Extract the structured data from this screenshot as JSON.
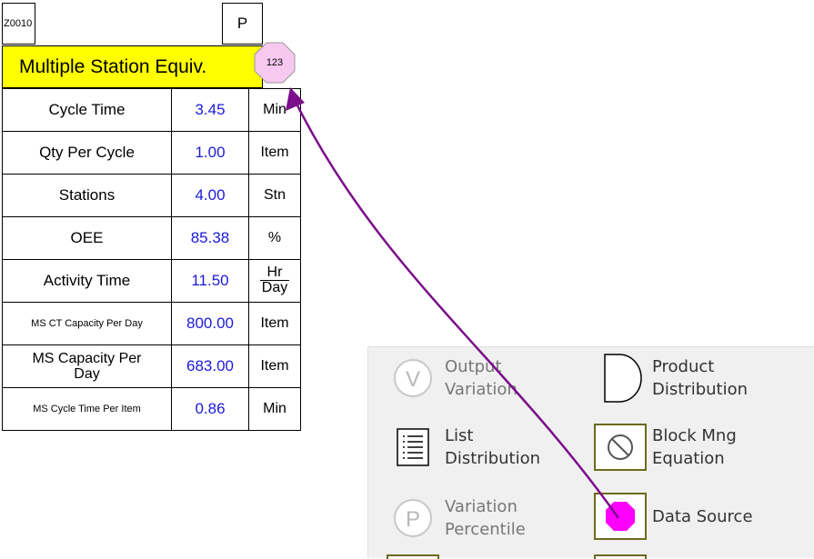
{
  "block": {
    "id": "Z0010",
    "type_letter": "P",
    "title": "Multiple Station Equiv.",
    "badge": "123",
    "rows": [
      {
        "label": "Cycle Time",
        "value": "3.45",
        "unit": "Min"
      },
      {
        "label": "Qty Per Cycle",
        "value": "1.00",
        "unit": "Item"
      },
      {
        "label": "Stations",
        "value": "4.00",
        "unit": "Stn"
      },
      {
        "label": "OEE",
        "value": "85.38",
        "unit": "%"
      },
      {
        "label": "Activity Time",
        "value": "11.50",
        "unit_num": "Hr",
        "unit_den": "Day"
      },
      {
        "label": "MS CT Capacity Per Day",
        "value": "800.00",
        "unit": "Item"
      },
      {
        "label": "MS Capacity Per Day",
        "value": "683.00",
        "unit": "Item"
      },
      {
        "label": "MS Cycle Time Per Item",
        "value": "0.86",
        "unit": "Min"
      }
    ]
  },
  "palette": {
    "items": [
      {
        "label_line1": "Output",
        "label_line2": "Variation",
        "icon": "v-circle-icon"
      },
      {
        "label_line1": "Product",
        "label_line2": "Distribution",
        "icon": "d-shape-icon"
      },
      {
        "label_line1": "List",
        "label_line2": "Distribution",
        "icon": "list-icon"
      },
      {
        "label_line1": "Block Mng",
        "label_line2": "Equation",
        "icon": "prohibited-icon"
      },
      {
        "label_line1": "Variation",
        "label_line2": "Percentile",
        "icon": "p-circle-icon"
      },
      {
        "label_line1": "Data Source",
        "label_line2": "",
        "icon": "magenta-octagon-icon"
      }
    ]
  },
  "colors": {
    "title_bg": "#ffff00",
    "value_text": "#1a1ad8",
    "arrow": "#7b0e8a",
    "badge_fill": "#f7c8f0",
    "octagon": "#ff00ff",
    "panel_bg": "#f0f0f0"
  }
}
